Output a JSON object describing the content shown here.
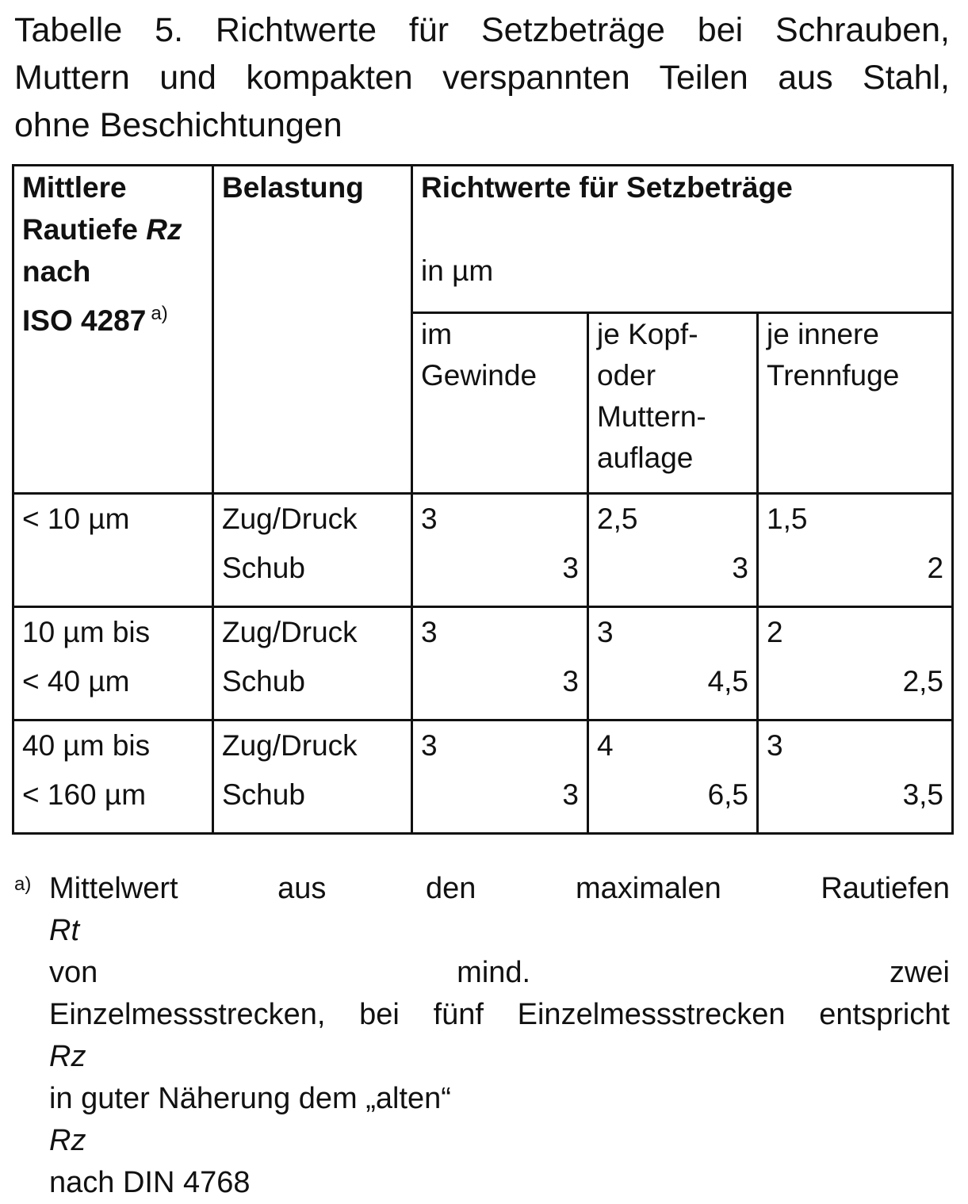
{
  "caption": {
    "line1": "Tabelle 5. Richtwerte für Setzbeträge bei Schrauben,",
    "line2": "Muttern und kompakten verspannten Teilen aus Stahl,",
    "line3": "ohne Beschichtungen"
  },
  "table": {
    "header": {
      "rz_line1": "Mittlere",
      "rz_line2a": "Rautiefe ",
      "rz_line2b": "Rz",
      "rz_line3": "nach",
      "rz_line4": "ISO 4287",
      "rz_footnote_mark": "a)",
      "belastung": "Belastung",
      "richtwerte_title": "Richtwerte für Setzbeträge",
      "richtwerte_unit": "in µm",
      "sub_gewinde_1": "im",
      "sub_gewinde_2": "Gewinde",
      "sub_kopf_1": "je Kopf-",
      "sub_kopf_2": "oder",
      "sub_kopf_3": "Muttern-",
      "sub_kopf_4": "auflage",
      "sub_trenn_1": "je innere",
      "sub_trenn_2": "Trennfuge"
    },
    "rows": [
      {
        "rz_1": "< 10 µm",
        "rz_2": "",
        "load_1": "Zug/Druck",
        "load_2": "Schub",
        "gewinde_1": "3",
        "gewinde_2": "3",
        "kopf_1": "2,5",
        "kopf_2": "3",
        "trenn_1": "1,5",
        "trenn_2": "2"
      },
      {
        "rz_1": "10 µm bis",
        "rz_2": "< 40 µm",
        "load_1": "Zug/Druck",
        "load_2": "Schub",
        "gewinde_1": "3",
        "gewinde_2": "3",
        "kopf_1": "3",
        "kopf_2": "4,5",
        "trenn_1": "2",
        "trenn_2": "2,5"
      },
      {
        "rz_1": "40 µm bis",
        "rz_2": "< 160 µm",
        "load_1": "Zug/Druck",
        "load_2": "Schub",
        "gewinde_1": "3",
        "gewinde_2": "3",
        "kopf_1": "4",
        "kopf_2": "6,5",
        "trenn_1": "3",
        "trenn_2": "3,5"
      }
    ]
  },
  "footnote": {
    "mark": "a)",
    "line1a": "Mittelwert aus den maximalen Rautiefen ",
    "line1b": "Rt",
    "line1c": " von mind. zwei",
    "line2": "Einzelmessstrecken, bei fünf Einzelmessstrecken entspricht",
    "line3a": "Rz",
    "line3b": " in guter Näherung dem „alten“ ",
    "line3c": "Rz",
    "line3d": " nach DIN 4768"
  }
}
